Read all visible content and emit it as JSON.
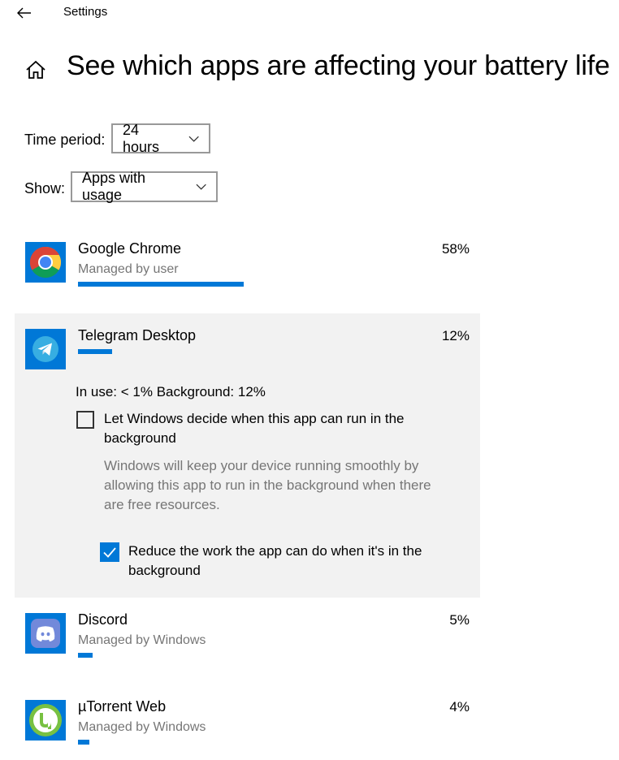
{
  "header": {
    "window_title": "Settings",
    "page_title": "See which apps are affecting your battery life"
  },
  "filters": {
    "time_period_label": "Time period:",
    "time_period_value": "24 hours",
    "show_label": "Show:",
    "show_value": "Apps with usage"
  },
  "apps": [
    {
      "name": "Google Chrome",
      "subtitle": "Managed by user",
      "percent": "58%",
      "usage_fraction": 0.58,
      "icon": "chrome-icon"
    },
    {
      "name": "Telegram Desktop",
      "subtitle": "",
      "percent": "12%",
      "usage_fraction": 0.12,
      "icon": "telegram-icon"
    },
    {
      "name": "Discord",
      "subtitle": "Managed by Windows",
      "percent": "5%",
      "usage_fraction": 0.05,
      "icon": "discord-icon"
    },
    {
      "name": "µTorrent Web",
      "subtitle": "Managed by Windows",
      "percent": "4%",
      "usage_fraction": 0.04,
      "icon": "utorrent-icon"
    }
  ],
  "expanded": {
    "usage_line": "In use: < 1% Background: 12%",
    "let_windows_line1": "Let Windows decide when this app can run in the",
    "let_windows_line2": "background",
    "let_windows_checked": false,
    "description_line1": "Windows will keep your device running smoothly by",
    "description_line2": "allowing this app to run in the background when there",
    "description_line3": "are free resources.",
    "reduce_line1": "Reduce the work the app can do when it's in the",
    "reduce_line2": "background",
    "reduce_checked": true
  },
  "colors": {
    "accent": "#0078d7",
    "panel_bg": "#f2f2f2",
    "secondary_text": "#767676"
  }
}
